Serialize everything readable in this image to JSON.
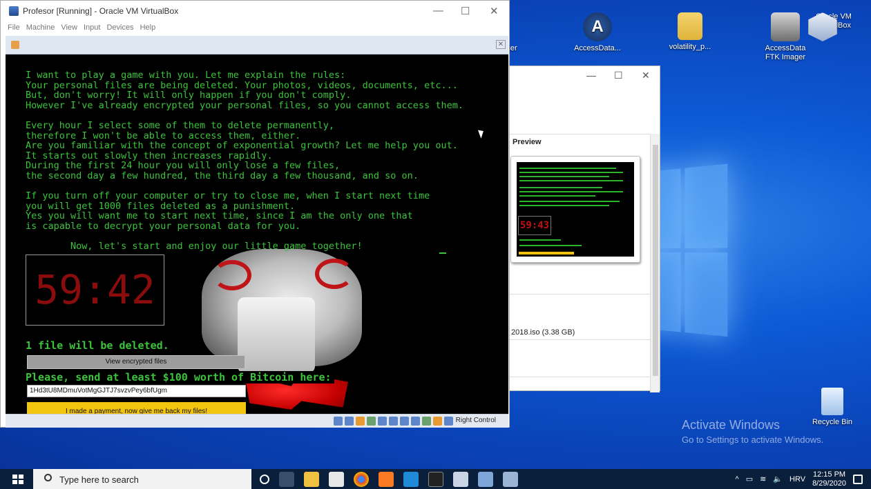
{
  "vbox": {
    "title": "Profesor [Running] - Oracle VM VirtualBox",
    "menu": [
      "File",
      "Machine",
      "View",
      "Input",
      "Devices",
      "Help"
    ],
    "status_host_key": "Right Control"
  },
  "ransom": {
    "message": "I want to play a game with you. Let me explain the rules:\nYour personal files are being deleted. Your photos, videos, documents, etc...\nBut, don't worry! It will only happen if you don't comply.\nHowever I've already encrypted your personal files, so you cannot access them.\n\nEvery hour I select some of them to delete permanently,\ntherefore I won't be able to access them, either.\nAre you familiar with the concept of exponential growth? Let me help you out.\nIt starts out slowly then increases rapidly.\nDuring the first 24 hour you will only lose a few files,\nthe second day a few hundred, the third day a few thousand, and so on.\n\nIf you turn off your computer or try to close me, when I start next time\nyou will get 1000 files deleted as a punishment.\nYes you will want me to start next time, since I am the only one that\nis capable to decrypt your personal data for you.\n\n        Now, let's start and enjoy our little game together!",
    "timer": "59:42",
    "deletion_notice": "1 file will be deleted.",
    "view_button": "View encrypted files",
    "bitcoin_prompt": "Please, send at least $100 worth of Bitcoin here:",
    "bitcoin_address": "1Hd3tU8MDmuVotMgGJTJ7svzvPey6bfUgm",
    "paid_button": "I made a payment, now give me back my files!",
    "thumb_timer": "59:43"
  },
  "explorer": {
    "preview_label": "Preview",
    "file_size_row": "2018.iso (3.38 GB)"
  },
  "desktop": {
    "icons": [
      {
        "label": "AccessData...",
        "icon": "accessdata-icon"
      },
      {
        "label": "volatility_p...",
        "icon": "folder-icon"
      },
      {
        "label": "AccessData FTK Imager",
        "icon": "ftk-imager-icon"
      },
      {
        "label": "Oracle VM VirtualBox",
        "icon": "virtualbox-icon"
      },
      {
        "label": "Recycle Bin",
        "icon": "recycle-bin-icon"
      }
    ],
    "partial_icon_label": "ser",
    "activate_title": "Activate Windows",
    "activate_sub": "Go to Settings to activate Windows."
  },
  "taskbar": {
    "search_placeholder": "Type here to search",
    "language": "HRV",
    "time": "12:15 PM",
    "date": "8/29/2020"
  },
  "colors": {
    "terminal_green": "#3cc43c",
    "timer_red": "#8b0c0c",
    "paid_yellow": "#f2c40e",
    "desktop_blue": "#0d5bd6"
  }
}
